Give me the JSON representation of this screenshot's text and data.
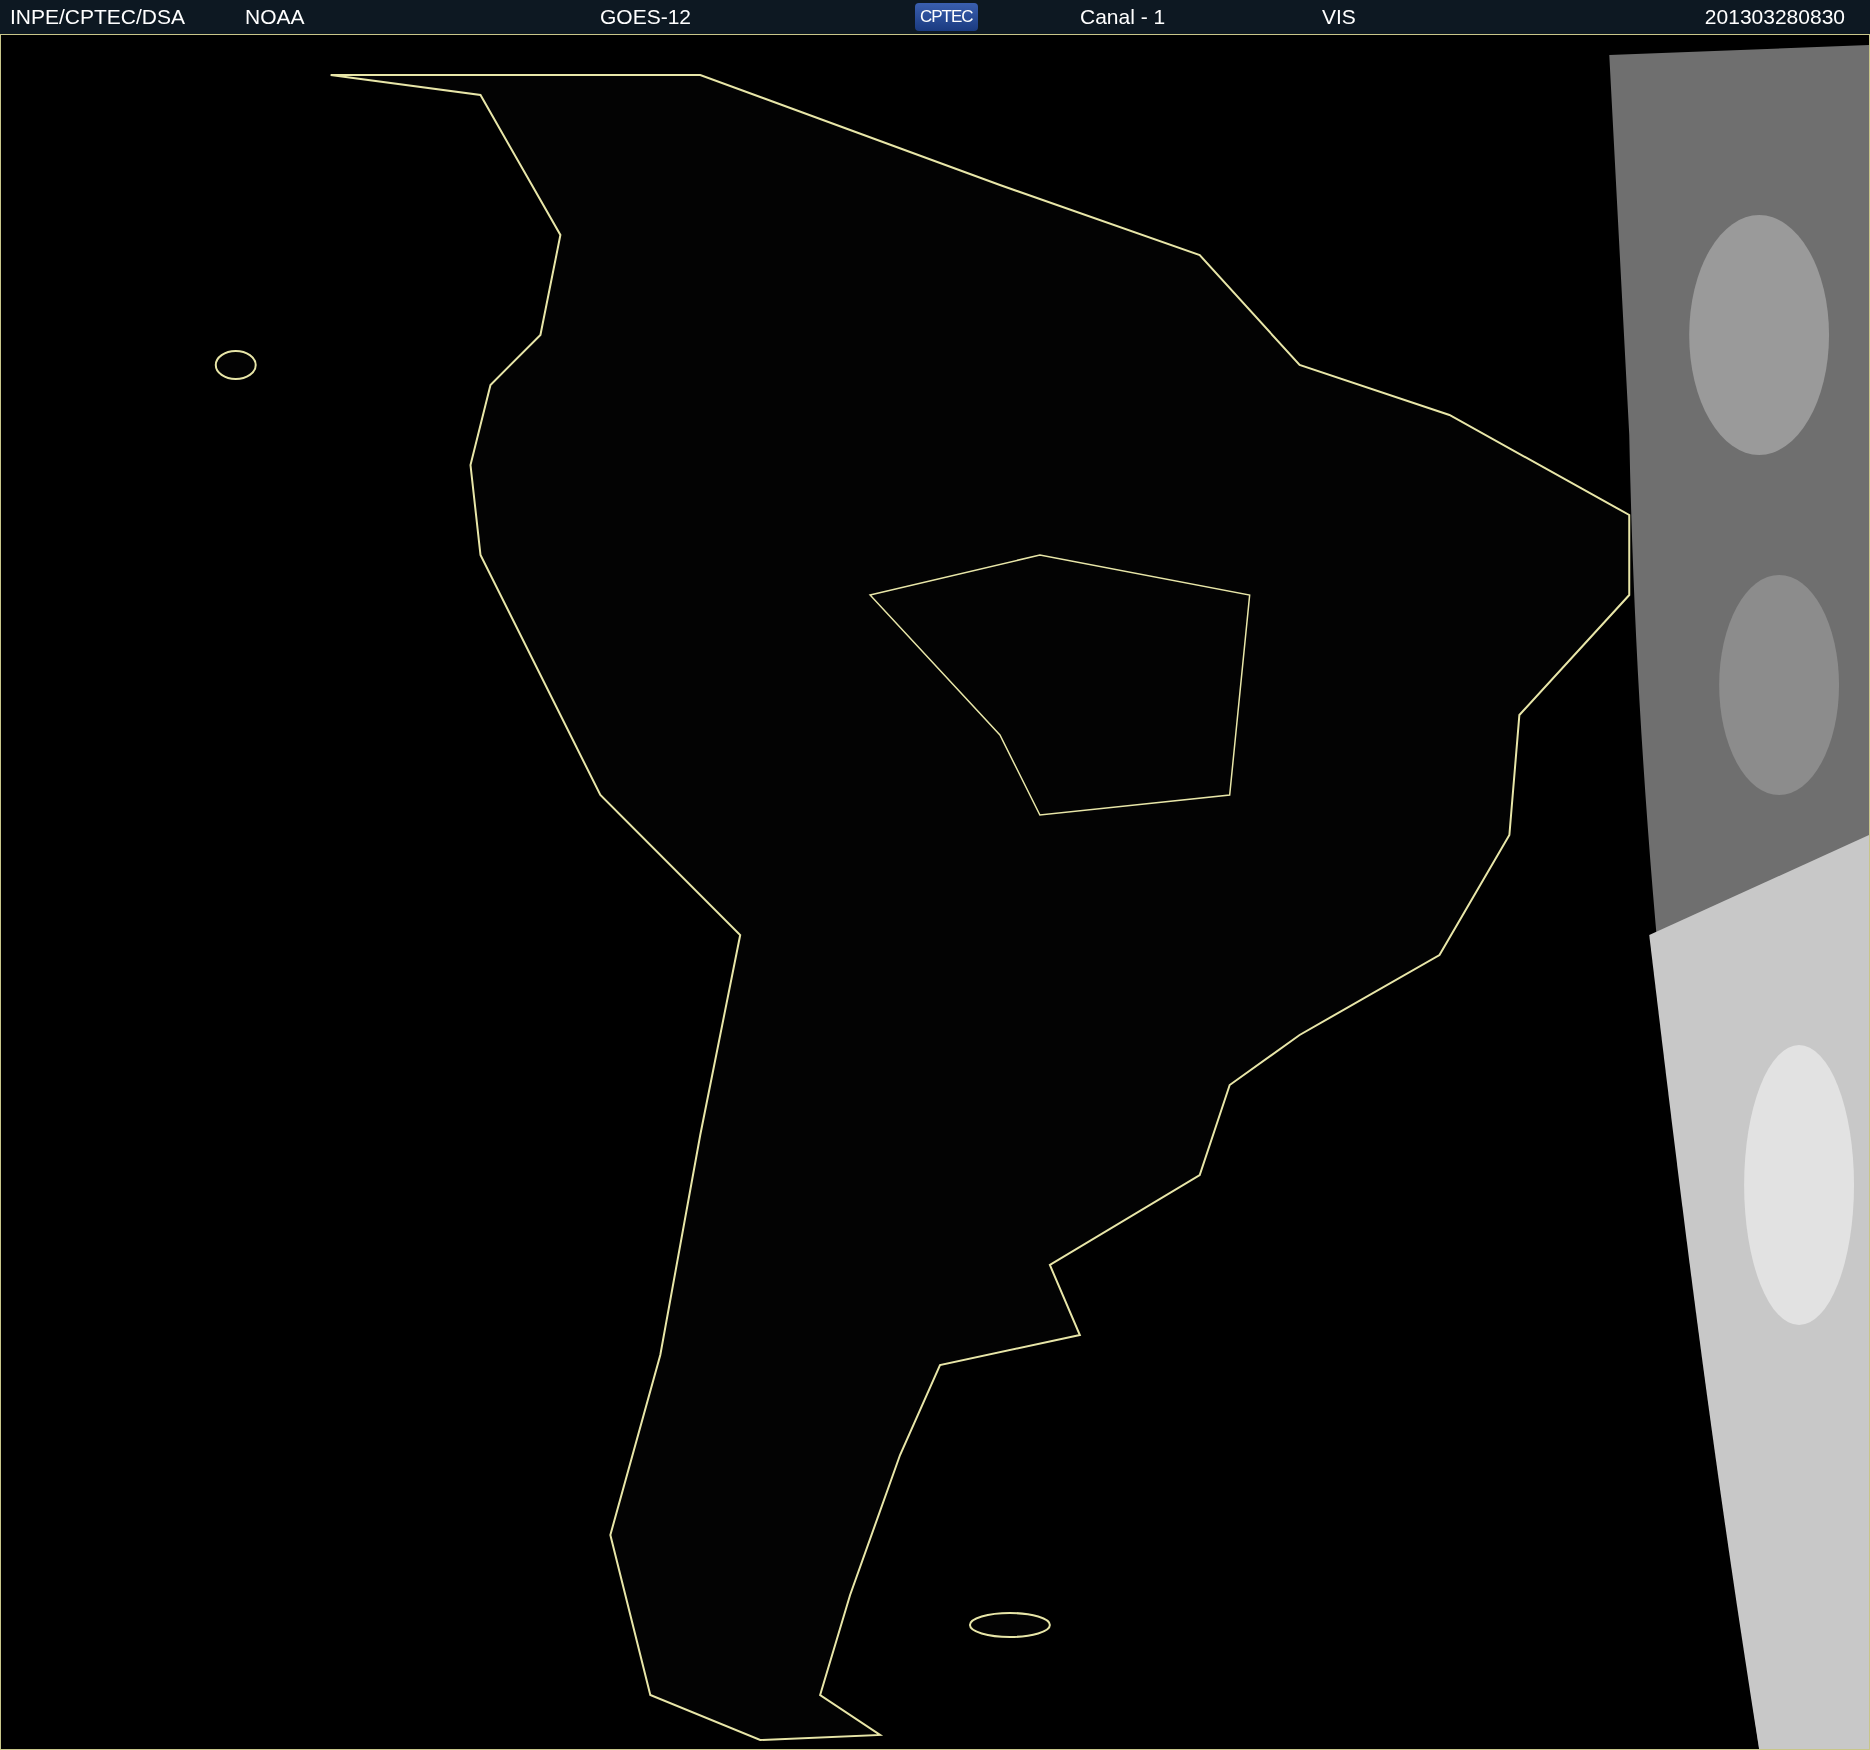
{
  "header": {
    "items": [
      {
        "kind": "text",
        "text": "INPE/CPTEC/DSA"
      },
      {
        "kind": "text",
        "text": "NOAA"
      },
      {
        "kind": "text",
        "text": "GOES-12"
      },
      {
        "kind": "logo",
        "text": "CPTEC"
      },
      {
        "kind": "text",
        "text": "Canal - 1"
      },
      {
        "kind": "text",
        "text": "VIS"
      },
      {
        "kind": "text",
        "text": "201303280830"
      }
    ]
  }
}
